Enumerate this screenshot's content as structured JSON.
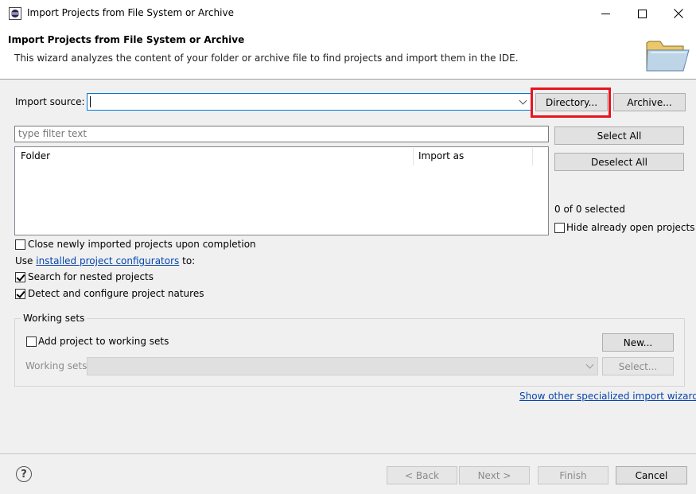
{
  "window": {
    "title": "Import Projects from File System or Archive"
  },
  "header": {
    "title": "Import Projects from File System or Archive",
    "description": "This wizard analyzes the content of your folder or archive file to find projects and import them in the IDE."
  },
  "import_source": {
    "label": "Import source:",
    "value": "",
    "directory_button": "Directory...",
    "archive_button": "Archive..."
  },
  "filter": {
    "placeholder": "type filter text"
  },
  "table": {
    "columns": [
      "Folder",
      "Import as"
    ],
    "rows": []
  },
  "side_buttons": {
    "select_all": "Select All",
    "deselect_all": "Deselect All"
  },
  "selection_status": "0 of 0 selected",
  "options": {
    "hide_open_projects": {
      "label": "Hide already open projects",
      "checked": false
    },
    "close_projects": {
      "label": "Close newly imported projects upon completion",
      "checked": false
    },
    "use_prefix": "Use",
    "configurators_link": "installed project configurators",
    "use_suffix": "to:",
    "search_nested": {
      "label": "Search for nested projects",
      "checked": true
    },
    "detect_natures": {
      "label": "Detect and configure project natures",
      "checked": true
    }
  },
  "working_sets": {
    "group_label": "Working sets",
    "add_checkbox": {
      "label": "Add project to working sets",
      "checked": false
    },
    "new_button": "New...",
    "sets_label": "Working sets:",
    "select_button": "Select..."
  },
  "specialized_link": "Show other specialized import wizards",
  "footer": {
    "help": "?",
    "back": "< Back",
    "next": "Next >",
    "finish": "Finish",
    "cancel": "Cancel"
  },
  "colors": {
    "highlight_box": "#e8141e",
    "link": "#0645ad",
    "focus_border": "#0078d7"
  }
}
